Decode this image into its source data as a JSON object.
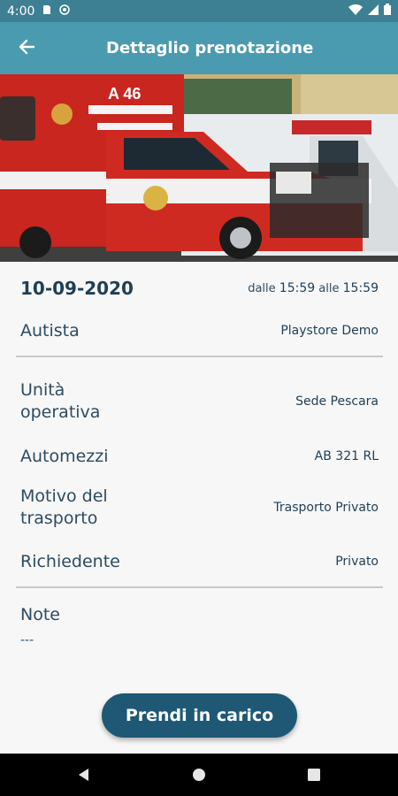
{
  "status_bar": {
    "time": "4:00",
    "icons": [
      "sd-card-icon",
      "at-sign-icon",
      "wifi-icon",
      "signal-icon",
      "battery-icon"
    ]
  },
  "app_bar": {
    "title": "Dettaglio prenotazione",
    "back_icon": "arrow-back-icon"
  },
  "hero": {
    "subject": "ambulance-photo"
  },
  "booking": {
    "date": "10-09-2020",
    "time_from_label": "dalle",
    "time_from": "15:59",
    "time_to_label": "alle",
    "time_to": "15:59",
    "driver_label": "Autista",
    "driver_value": "Playstore Demo",
    "unit_label_1": "Unità",
    "unit_label_2": "operativa",
    "unit_value": "Sede Pescara",
    "vehicles_label": "Automezzi",
    "vehicles_value": "AB 321 RL",
    "reason_label_1": "Motivo del",
    "reason_label_2": "trasporto",
    "reason_value": "Trasporto Privato",
    "requester_label": "Richiedente",
    "requester_value": "Privato",
    "notes_label": "Note",
    "notes_value": "---"
  },
  "actions": {
    "take_charge": "Prendi in carico"
  },
  "nav": {
    "icons": [
      "back-triangle-icon",
      "home-circle-icon",
      "recents-square-icon"
    ]
  },
  "colors": {
    "status_bar": "#3d7f93",
    "app_bar": "#4a9bb0",
    "button": "#1e5874",
    "text": "#2c4b63"
  }
}
